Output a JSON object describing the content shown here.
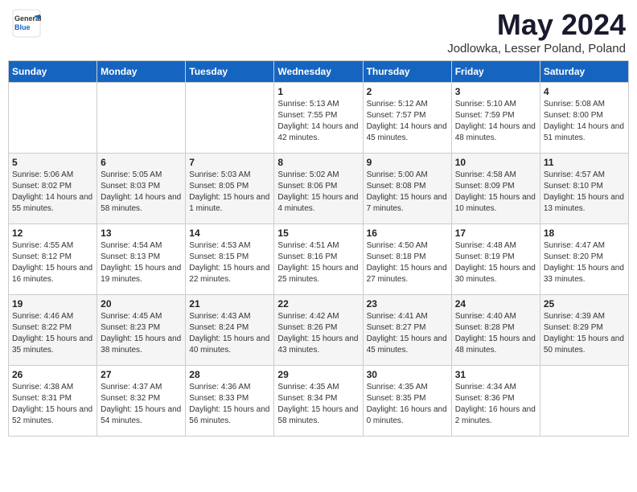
{
  "header": {
    "logo_general": "General",
    "logo_blue": "Blue",
    "title": "May 2024",
    "subtitle": "Jodlowka, Lesser Poland, Poland"
  },
  "days_of_week": [
    "Sunday",
    "Monday",
    "Tuesday",
    "Wednesday",
    "Thursday",
    "Friday",
    "Saturday"
  ],
  "weeks": [
    [
      {
        "day": "",
        "sunrise": "",
        "sunset": "",
        "daylight": ""
      },
      {
        "day": "",
        "sunrise": "",
        "sunset": "",
        "daylight": ""
      },
      {
        "day": "",
        "sunrise": "",
        "sunset": "",
        "daylight": ""
      },
      {
        "day": "1",
        "sunrise": "Sunrise: 5:13 AM",
        "sunset": "Sunset: 7:55 PM",
        "daylight": "Daylight: 14 hours and 42 minutes."
      },
      {
        "day": "2",
        "sunrise": "Sunrise: 5:12 AM",
        "sunset": "Sunset: 7:57 PM",
        "daylight": "Daylight: 14 hours and 45 minutes."
      },
      {
        "day": "3",
        "sunrise": "Sunrise: 5:10 AM",
        "sunset": "Sunset: 7:59 PM",
        "daylight": "Daylight: 14 hours and 48 minutes."
      },
      {
        "day": "4",
        "sunrise": "Sunrise: 5:08 AM",
        "sunset": "Sunset: 8:00 PM",
        "daylight": "Daylight: 14 hours and 51 minutes."
      }
    ],
    [
      {
        "day": "5",
        "sunrise": "Sunrise: 5:06 AM",
        "sunset": "Sunset: 8:02 PM",
        "daylight": "Daylight: 14 hours and 55 minutes."
      },
      {
        "day": "6",
        "sunrise": "Sunrise: 5:05 AM",
        "sunset": "Sunset: 8:03 PM",
        "daylight": "Daylight: 14 hours and 58 minutes."
      },
      {
        "day": "7",
        "sunrise": "Sunrise: 5:03 AM",
        "sunset": "Sunset: 8:05 PM",
        "daylight": "Daylight: 15 hours and 1 minute."
      },
      {
        "day": "8",
        "sunrise": "Sunrise: 5:02 AM",
        "sunset": "Sunset: 8:06 PM",
        "daylight": "Daylight: 15 hours and 4 minutes."
      },
      {
        "day": "9",
        "sunrise": "Sunrise: 5:00 AM",
        "sunset": "Sunset: 8:08 PM",
        "daylight": "Daylight: 15 hours and 7 minutes."
      },
      {
        "day": "10",
        "sunrise": "Sunrise: 4:58 AM",
        "sunset": "Sunset: 8:09 PM",
        "daylight": "Daylight: 15 hours and 10 minutes."
      },
      {
        "day": "11",
        "sunrise": "Sunrise: 4:57 AM",
        "sunset": "Sunset: 8:10 PM",
        "daylight": "Daylight: 15 hours and 13 minutes."
      }
    ],
    [
      {
        "day": "12",
        "sunrise": "Sunrise: 4:55 AM",
        "sunset": "Sunset: 8:12 PM",
        "daylight": "Daylight: 15 hours and 16 minutes."
      },
      {
        "day": "13",
        "sunrise": "Sunrise: 4:54 AM",
        "sunset": "Sunset: 8:13 PM",
        "daylight": "Daylight: 15 hours and 19 minutes."
      },
      {
        "day": "14",
        "sunrise": "Sunrise: 4:53 AM",
        "sunset": "Sunset: 8:15 PM",
        "daylight": "Daylight: 15 hours and 22 minutes."
      },
      {
        "day": "15",
        "sunrise": "Sunrise: 4:51 AM",
        "sunset": "Sunset: 8:16 PM",
        "daylight": "Daylight: 15 hours and 25 minutes."
      },
      {
        "day": "16",
        "sunrise": "Sunrise: 4:50 AM",
        "sunset": "Sunset: 8:18 PM",
        "daylight": "Daylight: 15 hours and 27 minutes."
      },
      {
        "day": "17",
        "sunrise": "Sunrise: 4:48 AM",
        "sunset": "Sunset: 8:19 PM",
        "daylight": "Daylight: 15 hours and 30 minutes."
      },
      {
        "day": "18",
        "sunrise": "Sunrise: 4:47 AM",
        "sunset": "Sunset: 8:20 PM",
        "daylight": "Daylight: 15 hours and 33 minutes."
      }
    ],
    [
      {
        "day": "19",
        "sunrise": "Sunrise: 4:46 AM",
        "sunset": "Sunset: 8:22 PM",
        "daylight": "Daylight: 15 hours and 35 minutes."
      },
      {
        "day": "20",
        "sunrise": "Sunrise: 4:45 AM",
        "sunset": "Sunset: 8:23 PM",
        "daylight": "Daylight: 15 hours and 38 minutes."
      },
      {
        "day": "21",
        "sunrise": "Sunrise: 4:43 AM",
        "sunset": "Sunset: 8:24 PM",
        "daylight": "Daylight: 15 hours and 40 minutes."
      },
      {
        "day": "22",
        "sunrise": "Sunrise: 4:42 AM",
        "sunset": "Sunset: 8:26 PM",
        "daylight": "Daylight: 15 hours and 43 minutes."
      },
      {
        "day": "23",
        "sunrise": "Sunrise: 4:41 AM",
        "sunset": "Sunset: 8:27 PM",
        "daylight": "Daylight: 15 hours and 45 minutes."
      },
      {
        "day": "24",
        "sunrise": "Sunrise: 4:40 AM",
        "sunset": "Sunset: 8:28 PM",
        "daylight": "Daylight: 15 hours and 48 minutes."
      },
      {
        "day": "25",
        "sunrise": "Sunrise: 4:39 AM",
        "sunset": "Sunset: 8:29 PM",
        "daylight": "Daylight: 15 hours and 50 minutes."
      }
    ],
    [
      {
        "day": "26",
        "sunrise": "Sunrise: 4:38 AM",
        "sunset": "Sunset: 8:31 PM",
        "daylight": "Daylight: 15 hours and 52 minutes."
      },
      {
        "day": "27",
        "sunrise": "Sunrise: 4:37 AM",
        "sunset": "Sunset: 8:32 PM",
        "daylight": "Daylight: 15 hours and 54 minutes."
      },
      {
        "day": "28",
        "sunrise": "Sunrise: 4:36 AM",
        "sunset": "Sunset: 8:33 PM",
        "daylight": "Daylight: 15 hours and 56 minutes."
      },
      {
        "day": "29",
        "sunrise": "Sunrise: 4:35 AM",
        "sunset": "Sunset: 8:34 PM",
        "daylight": "Daylight: 15 hours and 58 minutes."
      },
      {
        "day": "30",
        "sunrise": "Sunrise: 4:35 AM",
        "sunset": "Sunset: 8:35 PM",
        "daylight": "Daylight: 16 hours and 0 minutes."
      },
      {
        "day": "31",
        "sunrise": "Sunrise: 4:34 AM",
        "sunset": "Sunset: 8:36 PM",
        "daylight": "Daylight: 16 hours and 2 minutes."
      },
      {
        "day": "",
        "sunrise": "",
        "sunset": "",
        "daylight": ""
      }
    ]
  ]
}
